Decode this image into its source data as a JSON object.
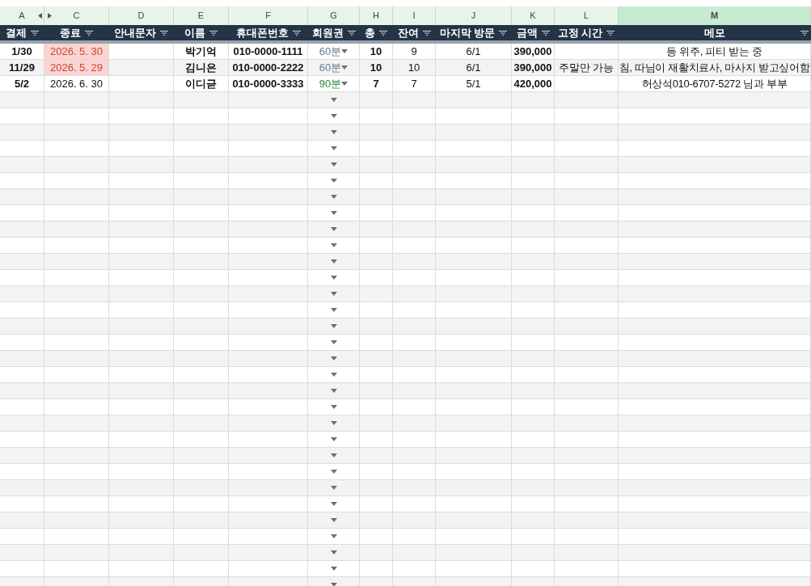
{
  "column_letters": [
    {
      "letter": "A",
      "selected": false
    },
    {
      "letter": "C",
      "selected": false
    },
    {
      "letter": "D",
      "selected": false
    },
    {
      "letter": "E",
      "selected": false
    },
    {
      "letter": "F",
      "selected": false
    },
    {
      "letter": "G",
      "selected": false
    },
    {
      "letter": "H",
      "selected": false
    },
    {
      "letter": "I",
      "selected": false
    },
    {
      "letter": "J",
      "selected": false
    },
    {
      "letter": "K",
      "selected": false
    },
    {
      "letter": "L",
      "selected": false
    },
    {
      "letter": "M",
      "selected": true
    }
  ],
  "headers": [
    "결제",
    "종료",
    "안내문자",
    "이름",
    "휴대폰번호",
    "회원권",
    "총",
    "잔여",
    "마지막 방문",
    "금액",
    "고정 시간",
    "메모"
  ],
  "rows": [
    {
      "dropdown": true,
      "cells": [
        {
          "text": "1/30"
        },
        {
          "text": "2026. 5. 30",
          "expired": true
        },
        {},
        {
          "text": "박기억"
        },
        {
          "text": "010-0000-1111"
        },
        {
          "text": "60분",
          "color": "#6b7a90"
        },
        {
          "text": "10"
        },
        {
          "text": "9"
        },
        {
          "text": "6/1"
        },
        {
          "text": "390,000"
        },
        {},
        {
          "text": "등 위주, 피티 받는 중"
        }
      ]
    },
    {
      "dropdown": true,
      "cells": [
        {
          "text": "11/29"
        },
        {
          "text": "2026. 5. 29",
          "expired": true
        },
        {},
        {
          "text": "김니은"
        },
        {
          "text": "010-0000-2222"
        },
        {
          "text": "60분",
          "color": "#6b7a90"
        },
        {
          "text": "10"
        },
        {
          "text": "10"
        },
        {
          "text": "6/1"
        },
        {
          "text": "390,000"
        },
        {
          "text": "주말만 가능"
        },
        {
          "text": "침, 따님이 재활치료사, 마사지 받고싶어함"
        }
      ]
    },
    {
      "dropdown": true,
      "cells": [
        {
          "text": "5/2"
        },
        {
          "text": "2026. 6. 30",
          "expired": false
        },
        {},
        {
          "text": "이디귿"
        },
        {
          "text": "010-0000-3333"
        },
        {
          "text": "90분",
          "color": "#2e8b3e"
        },
        {
          "text": "7"
        },
        {
          "text": "7"
        },
        {
          "text": "5/1"
        },
        {
          "text": "420,000"
        },
        {},
        {
          "text": "허상석010-6707-5272 님과 부부"
        }
      ]
    },
    {
      "dropdown": true,
      "cells": []
    },
    {
      "dropdown": true,
      "cells": []
    },
    {
      "dropdown": true,
      "cells": []
    },
    {
      "dropdown": true,
      "cells": []
    },
    {
      "dropdown": true,
      "cells": []
    },
    {
      "dropdown": true,
      "cells": []
    },
    {
      "dropdown": true,
      "cells": []
    },
    {
      "dropdown": true,
      "cells": []
    },
    {
      "dropdown": true,
      "cells": []
    },
    {
      "dropdown": true,
      "cells": []
    },
    {
      "dropdown": true,
      "cells": []
    },
    {
      "dropdown": true,
      "cells": []
    },
    {
      "dropdown": true,
      "cells": []
    },
    {
      "dropdown": true,
      "cells": []
    },
    {
      "dropdown": true,
      "cells": []
    },
    {
      "dropdown": true,
      "cells": []
    },
    {
      "dropdown": true,
      "cells": []
    },
    {
      "dropdown": true,
      "cells": []
    },
    {
      "dropdown": true,
      "cells": []
    },
    {
      "dropdown": true,
      "cells": []
    },
    {
      "dropdown": true,
      "cells": []
    },
    {
      "dropdown": true,
      "cells": []
    },
    {
      "dropdown": true,
      "cells": []
    },
    {
      "dropdown": true,
      "cells": []
    },
    {
      "dropdown": true,
      "cells": []
    },
    {
      "dropdown": true,
      "cells": []
    },
    {
      "dropdown": true,
      "cells": []
    },
    {
      "dropdown": true,
      "cells": []
    },
    {
      "dropdown": true,
      "cells": []
    },
    {
      "dropdown": true,
      "cells": []
    },
    {
      "dropdown": true,
      "cells": []
    }
  ]
}
